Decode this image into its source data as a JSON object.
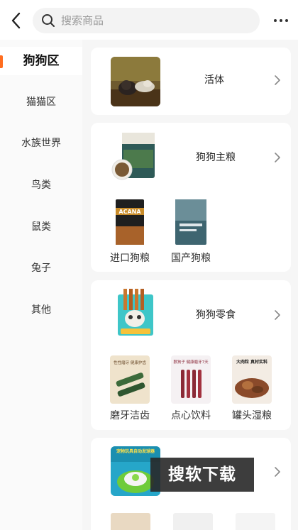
{
  "header": {
    "search_placeholder": "搜索商品"
  },
  "sidebar": {
    "items": [
      {
        "label": "狗狗区",
        "active": true
      },
      {
        "label": "猫猫区"
      },
      {
        "label": "水族世界"
      },
      {
        "label": "鸟类"
      },
      {
        "label": "鼠类"
      },
      {
        "label": "兔子"
      },
      {
        "label": "其他"
      }
    ]
  },
  "cards": [
    {
      "title": "活体",
      "subcategories": []
    },
    {
      "title": "狗狗主粮",
      "subcategories": [
        {
          "label": "进口狗粮"
        },
        {
          "label": "国产狗粮"
        }
      ]
    },
    {
      "title": "狗狗零食",
      "subcategories": [
        {
          "label": "磨牙洁齿"
        },
        {
          "label": "点心饮料"
        },
        {
          "label": "罐头湿粮"
        }
      ]
    },
    {
      "title": "",
      "subcategories": []
    }
  ],
  "image_text": {
    "food_bag_brand": "ACANA",
    "toy_banner": "宠物玩具自动发球器",
    "snack_chew": "性性磨牙 健康护齿",
    "snack_treat": "狠狗子 健康磨牙7天",
    "canned": "大肉粒 真材实料"
  },
  "watermark": "搜软下载",
  "colors": {
    "accent": "#ff6d1f",
    "background": "#f6f6f6"
  }
}
